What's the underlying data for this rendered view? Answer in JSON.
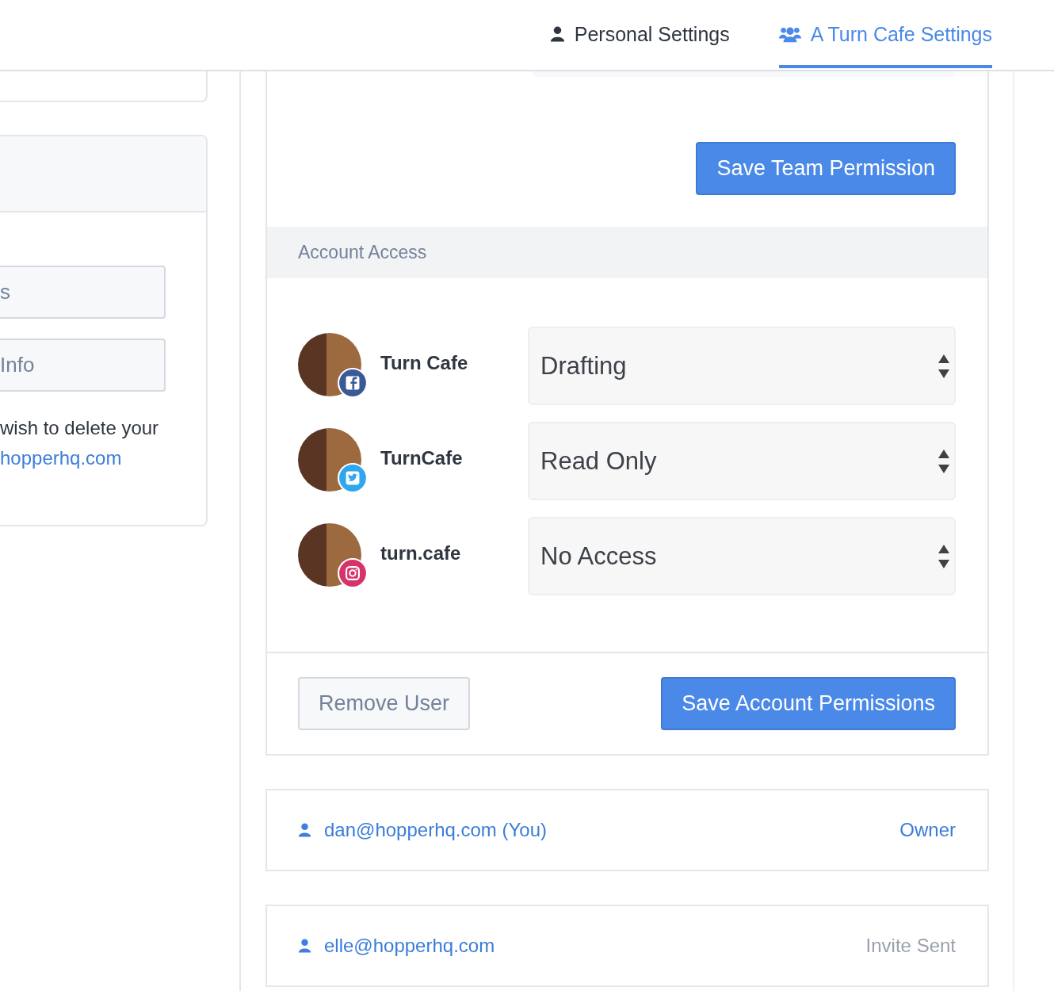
{
  "tabs": [
    {
      "label": "Personal Settings",
      "kind": "person",
      "selected": false
    },
    {
      "label": "A Turn Cafe Settings",
      "kind": "team",
      "selected": true
    }
  ],
  "left_panel": {
    "buttons": [
      "s",
      "Info"
    ],
    "text": "wish to delete your",
    "link": "hopperhq.com"
  },
  "team_permission": {
    "save_button": "Save Team Permission"
  },
  "account_access": {
    "heading": "Account Access",
    "accounts": [
      {
        "name": "Turn Cafe",
        "kind": "facebook",
        "permission": "Drafting"
      },
      {
        "name": "TurnCafe",
        "kind": "twitter",
        "permission": "Read Only"
      },
      {
        "name": "turn.cafe",
        "kind": "instagram",
        "permission": "No Access"
      }
    ],
    "remove_button": "Remove User",
    "save_button": "Save Account Permissions"
  },
  "users": [
    {
      "email": "dan@hopperhq.com (You)",
      "role": "Owner",
      "kind": "member"
    },
    {
      "email": "elle@hopperhq.com",
      "role": "Invite Sent",
      "kind": "pending"
    }
  ]
}
